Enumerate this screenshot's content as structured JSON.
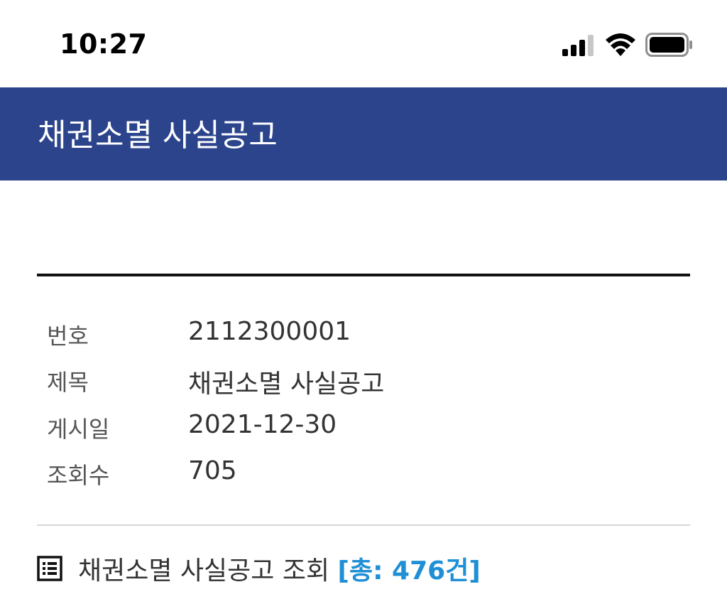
{
  "status_bar": {
    "time": "10:27",
    "icons": [
      "signal-icon",
      "wifi-icon",
      "battery-icon"
    ]
  },
  "header": {
    "title": "채권소멸 사실공고",
    "background_color": "#2b448c"
  },
  "detail": {
    "rows": [
      {
        "label": "번호",
        "value": "2112300001"
      },
      {
        "label": "제목",
        "value": "채권소멸 사실공고"
      },
      {
        "label": "게시일",
        "value": "2021-12-30"
      },
      {
        "label": "조회수",
        "value": "705"
      }
    ]
  },
  "list_section": {
    "icon": "list-icon",
    "title": "채권소멸 사실공고 조회",
    "count_text": "[총: 476건]",
    "count_color": "#1f8fd6"
  }
}
